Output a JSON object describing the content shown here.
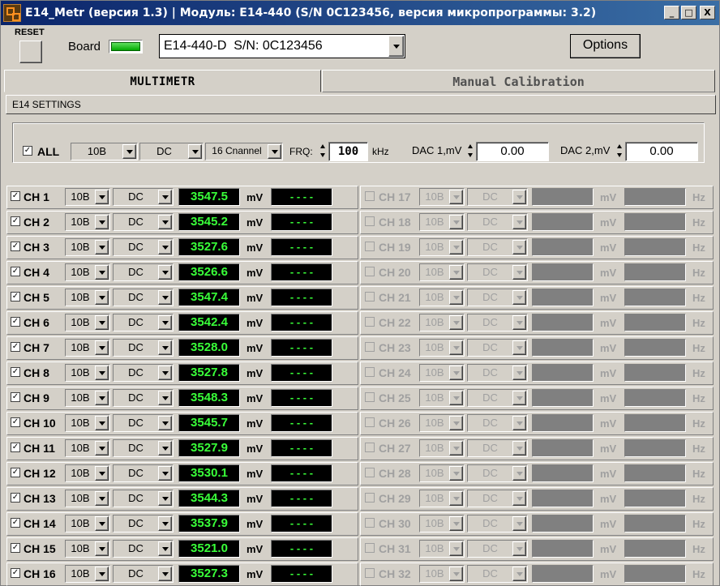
{
  "title": "E14_Metr (версия 1.3) | Модуль: E14-440 (S/N 0C123456, версия микропрограммы: 3.2)",
  "window_controls": {
    "minimize": "_",
    "maximize": "□",
    "close": "X"
  },
  "header": {
    "reset_label": "RESET",
    "board_label": "Board",
    "board_status_color": "#00c000",
    "device": "E14-440-D  S/N: 0C123456",
    "options_label": "Options"
  },
  "tabs": [
    {
      "label": "MULTIMETR",
      "active": true
    },
    {
      "label": "Manual Calibration",
      "active": false
    }
  ],
  "settings": {
    "section_label": "E14 SETTINGS",
    "all_label": "ALL",
    "all_checked": true,
    "range": "10B",
    "coupling": "DC",
    "channels": "16 Cnannel",
    "frq_label": "FRQ:",
    "frq_value": "100",
    "frq_unit": "kHz",
    "dac1_label": "DAC 1,mV",
    "dac1_value": "0.00",
    "dac2_label": "DAC 2,mV",
    "dac2_value": "0.00"
  },
  "units": {
    "voltage": "mV",
    "frequency": "Hz"
  },
  "checkmark": "✓",
  "channels_left": [
    {
      "label": "CH 1",
      "enabled": true,
      "range": "10B",
      "coupling": "DC",
      "value": "3547.5",
      "freq": "- - - -"
    },
    {
      "label": "CH 2",
      "enabled": true,
      "range": "10B",
      "coupling": "DC",
      "value": "3545.2",
      "freq": "- - - -"
    },
    {
      "label": "CH 3",
      "enabled": true,
      "range": "10B",
      "coupling": "DC",
      "value": "3527.6",
      "freq": "- - - -"
    },
    {
      "label": "CH 4",
      "enabled": true,
      "range": "10B",
      "coupling": "DC",
      "value": "3526.6",
      "freq": "- - - -"
    },
    {
      "label": "CH 5",
      "enabled": true,
      "range": "10B",
      "coupling": "DC",
      "value": "3547.4",
      "freq": "- - - -"
    },
    {
      "label": "CH 6",
      "enabled": true,
      "range": "10B",
      "coupling": "DC",
      "value": "3542.4",
      "freq": "- - - -"
    },
    {
      "label": "CH 7",
      "enabled": true,
      "range": "10B",
      "coupling": "DC",
      "value": "3528.0",
      "freq": "- - - -"
    },
    {
      "label": "CH 8",
      "enabled": true,
      "range": "10B",
      "coupling": "DC",
      "value": "3527.8",
      "freq": "- - - -"
    },
    {
      "label": "CH 9",
      "enabled": true,
      "range": "10B",
      "coupling": "DC",
      "value": "3548.3",
      "freq": "- - - -"
    },
    {
      "label": "CH 10",
      "enabled": true,
      "range": "10B",
      "coupling": "DC",
      "value": "3545.7",
      "freq": "- - - -"
    },
    {
      "label": "CH 11",
      "enabled": true,
      "range": "10B",
      "coupling": "DC",
      "value": "3527.9",
      "freq": "- - - -"
    },
    {
      "label": "CH 12",
      "enabled": true,
      "range": "10B",
      "coupling": "DC",
      "value": "3530.1",
      "freq": "- - - -"
    },
    {
      "label": "CH 13",
      "enabled": true,
      "range": "10B",
      "coupling": "DC",
      "value": "3544.3",
      "freq": "- - - -"
    },
    {
      "label": "CH 14",
      "enabled": true,
      "range": "10B",
      "coupling": "DC",
      "value": "3537.9",
      "freq": "- - - -"
    },
    {
      "label": "CH 15",
      "enabled": true,
      "range": "10B",
      "coupling": "DC",
      "value": "3521.0",
      "freq": "- - - -"
    },
    {
      "label": "CH 16",
      "enabled": true,
      "range": "10B",
      "coupling": "DC",
      "value": "3527.3",
      "freq": "- - - -"
    }
  ],
  "channels_right": [
    {
      "label": "CH 17",
      "enabled": false,
      "range": "10B",
      "coupling": "DC"
    },
    {
      "label": "CH 18",
      "enabled": false,
      "range": "10B",
      "coupling": "DC"
    },
    {
      "label": "CH 19",
      "enabled": false,
      "range": "10B",
      "coupling": "DC"
    },
    {
      "label": "CH 20",
      "enabled": false,
      "range": "10B",
      "coupling": "DC"
    },
    {
      "label": "CH 21",
      "enabled": false,
      "range": "10B",
      "coupling": "DC"
    },
    {
      "label": "CH 22",
      "enabled": false,
      "range": "10B",
      "coupling": "DC"
    },
    {
      "label": "CH 23",
      "enabled": false,
      "range": "10B",
      "coupling": "DC"
    },
    {
      "label": "CH 24",
      "enabled": false,
      "range": "10B",
      "coupling": "DC"
    },
    {
      "label": "CH 25",
      "enabled": false,
      "range": "10B",
      "coupling": "DC"
    },
    {
      "label": "CH 26",
      "enabled": false,
      "range": "10B",
      "coupling": "DC"
    },
    {
      "label": "CH 27",
      "enabled": false,
      "range": "10B",
      "coupling": "DC"
    },
    {
      "label": "CH 28",
      "enabled": false,
      "range": "10B",
      "coupling": "DC"
    },
    {
      "label": "CH 29",
      "enabled": false,
      "range": "10B",
      "coupling": "DC"
    },
    {
      "label": "CH 30",
      "enabled": false,
      "range": "10B",
      "coupling": "DC"
    },
    {
      "label": "CH 31",
      "enabled": false,
      "range": "10B",
      "coupling": "DC"
    },
    {
      "label": "CH 32",
      "enabled": false,
      "range": "10B",
      "coupling": "DC"
    }
  ]
}
